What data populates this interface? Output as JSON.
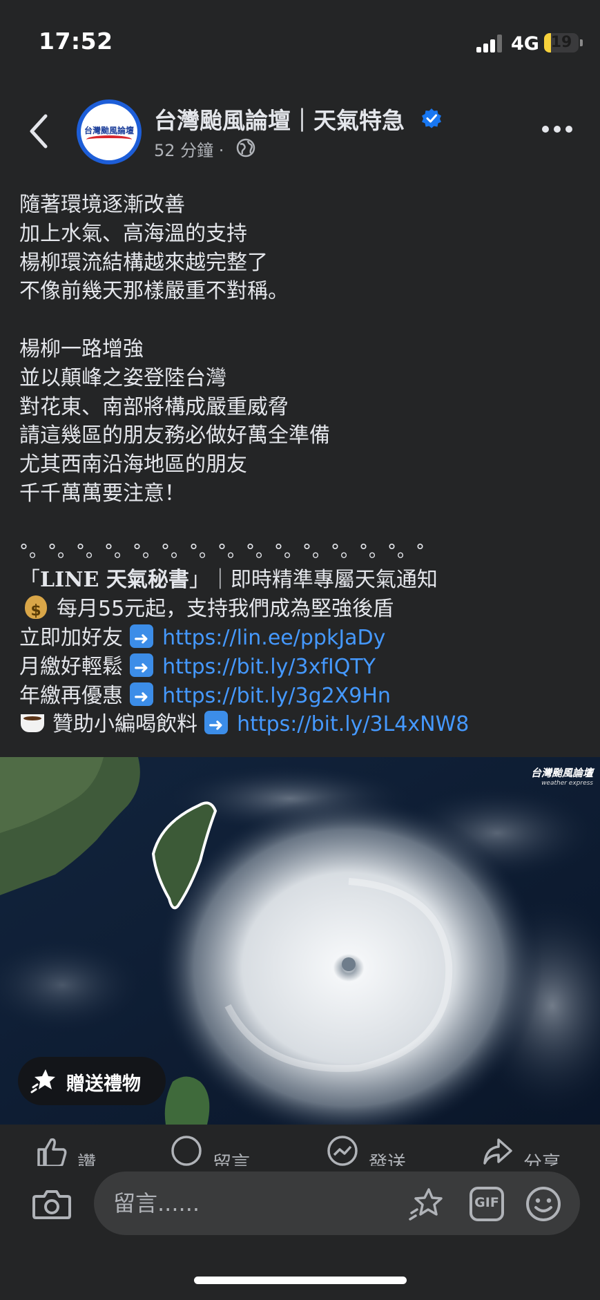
{
  "status_bar": {
    "time": "17:52",
    "network": "4G",
    "battery": "19",
    "battery_level": 0.19
  },
  "header": {
    "page_name": "台灣颱風論壇｜天氣特急",
    "post_age": "52 分鐘 ·",
    "avatar_logo_text": "台灣颱風論壇",
    "icons": [
      "back-icon",
      "verified-badge-icon",
      "globe-icon",
      "more-options-icon"
    ],
    "accent_color": "#1877f2"
  },
  "post": {
    "lines_block1": [
      "隨著環境逐漸改善",
      "加上水氣、高海溫的支持",
      "楊柳環流結構越來越完整了",
      "不像前幾天那樣嚴重不對稱。"
    ],
    "lines_block2": [
      "楊柳一路增強",
      "並以顛峰之姿登陸台灣",
      "對花東、南部將構成嚴重威脅",
      "請這幾區的朋友務必做好萬全準備",
      "尤其西南沿海地區的朋友",
      "千千萬萬要注意！"
    ],
    "divider": "°。°。°。°。°。°。°。°。°。°。°。°。°。°。°",
    "line_promo_prefix": "「",
    "line_promo_brand": "LINE 天氣秘書",
    "line_promo_rest": "」｜即時精準專屬天氣通知",
    "support_text": "每月55元起，支持我們成為堅強後盾",
    "links": [
      {
        "label": "立即加好友",
        "url": "https://lin.ee/ppkJaDy"
      },
      {
        "label": "月繳好輕鬆",
        "url": "https://bit.ly/3xfIQTY"
      },
      {
        "label": "年繳再優惠",
        "url": "https://bit.ly/3g2X9Hn"
      }
    ],
    "coffee_link": {
      "label": "贊助小編喝飲料",
      "url": "https://bit.ly/3L4xNW8"
    },
    "link_color": "#4599ff"
  },
  "image": {
    "description_icon": "satellite-typhoon-image",
    "watermark": "台灣颱風論壇",
    "watermark_sub": "weather express",
    "gift_label": "贈送禮物"
  },
  "actions": {
    "like": "讚",
    "comment": "留言",
    "send": "發送",
    "share": "分享"
  },
  "composer": {
    "placeholder": "留言......"
  }
}
